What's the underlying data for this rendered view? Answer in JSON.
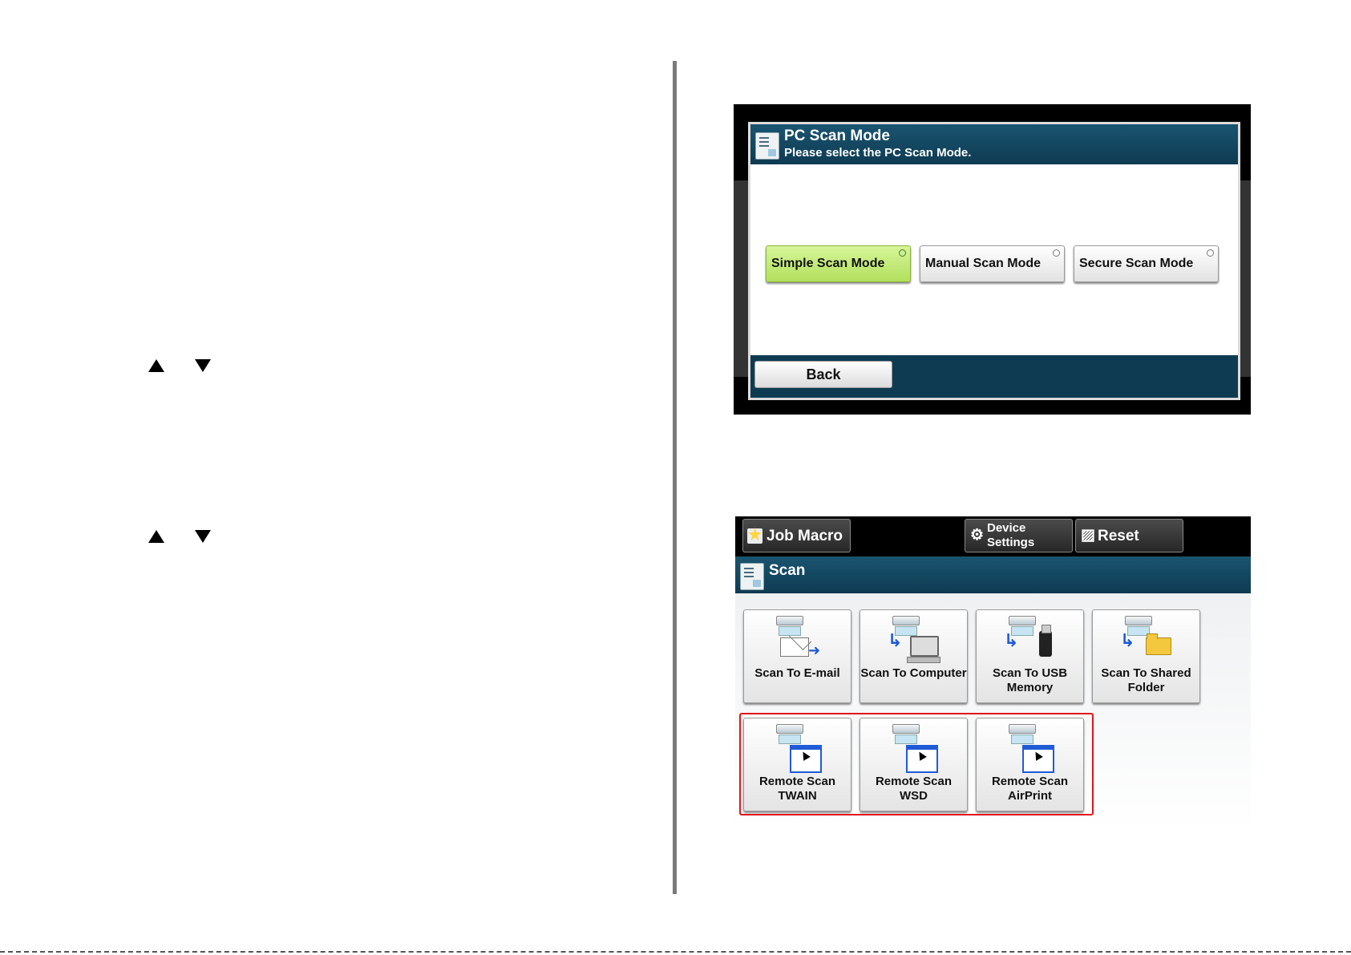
{
  "pc_scan_mode": {
    "title": "PC Scan Mode",
    "subtitle": "Please select the PC Scan Mode.",
    "modes": [
      "Simple Scan Mode",
      "Manual Scan Mode",
      "Secure Scan Mode"
    ],
    "selected_mode": "Simple Scan Mode",
    "back_label": "Back"
  },
  "scan_menu": {
    "top_bar": {
      "job_macro_label": "Job Macro",
      "device_settings_label": "Device\nSettings",
      "reset_label": "Reset"
    },
    "title": "Scan",
    "tiles": [
      {
        "label": "Scan To E-mail",
        "icon": "scan-to-email-icon"
      },
      {
        "label": "Scan To Computer",
        "icon": "scan-to-computer-icon"
      },
      {
        "label": "Scan To USB\nMemory",
        "icon": "scan-to-usb-icon"
      },
      {
        "label": "Scan To Shared\nFolder",
        "icon": "scan-to-shared-folder-icon"
      },
      {
        "label": "Remote Scan\nTWAIN",
        "icon": "remote-scan-icon"
      },
      {
        "label": "Remote Scan WSD",
        "icon": "remote-scan-icon"
      },
      {
        "label": "Remote Scan\nAirPrint",
        "icon": "remote-scan-icon"
      }
    ],
    "highlight_color": "#e0161c"
  }
}
